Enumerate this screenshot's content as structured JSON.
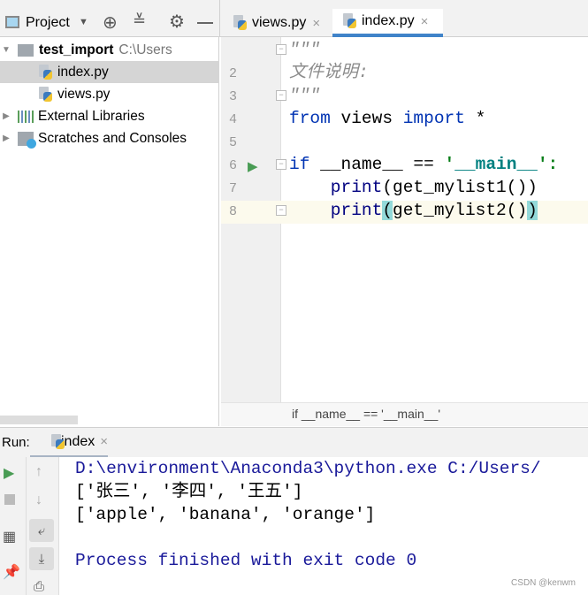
{
  "toolbar": {
    "project_label": "Project"
  },
  "tabs": [
    {
      "label": "views.py",
      "active": false
    },
    {
      "label": "index.py",
      "active": true
    }
  ],
  "tree": {
    "root": "test_import",
    "root_path": "C:\\Users",
    "files": [
      "index.py",
      "views.py"
    ],
    "external": "External Libraries",
    "scratches": "Scratches and Consoles"
  },
  "editor": {
    "lines": [
      "2",
      "3",
      "4",
      "5",
      "6",
      "7",
      "8"
    ],
    "code": {
      "l1": "\"\"\"",
      "l2": "文件说明:",
      "l3": "\"\"\"",
      "l4_from": "from",
      "l4_mod": " views ",
      "l4_import": "import",
      "l4_star": " *",
      "l6_if": "if",
      "l6_name": " __name__ == ",
      "l6_q1": "'",
      "l6_main": "__main__",
      "l6_q2": "':",
      "l7_print": "    print",
      "l7_rest": "(get_mylist1())",
      "l8_print": "    print",
      "l8_p1": "(",
      "l8_mid": "get_mylist2()",
      "l8_p2": ")"
    }
  },
  "breadcrumb": "if __name__ == '__main__'",
  "run": {
    "label": "Run:",
    "tab": "index"
  },
  "console": [
    "D:\\environment\\Anaconda3\\python.exe C:/Users/",
    "['张三', '李四', '王五']",
    "['apple', 'banana', 'orange']",
    "Process finished with exit code 0"
  ],
  "watermark": "CSDN @kenwm",
  "colors": {
    "keyword": "#0033b3",
    "tab_accent": "#4083c9",
    "console_blue": "#1a1a9a",
    "run_green": "#499c54"
  }
}
